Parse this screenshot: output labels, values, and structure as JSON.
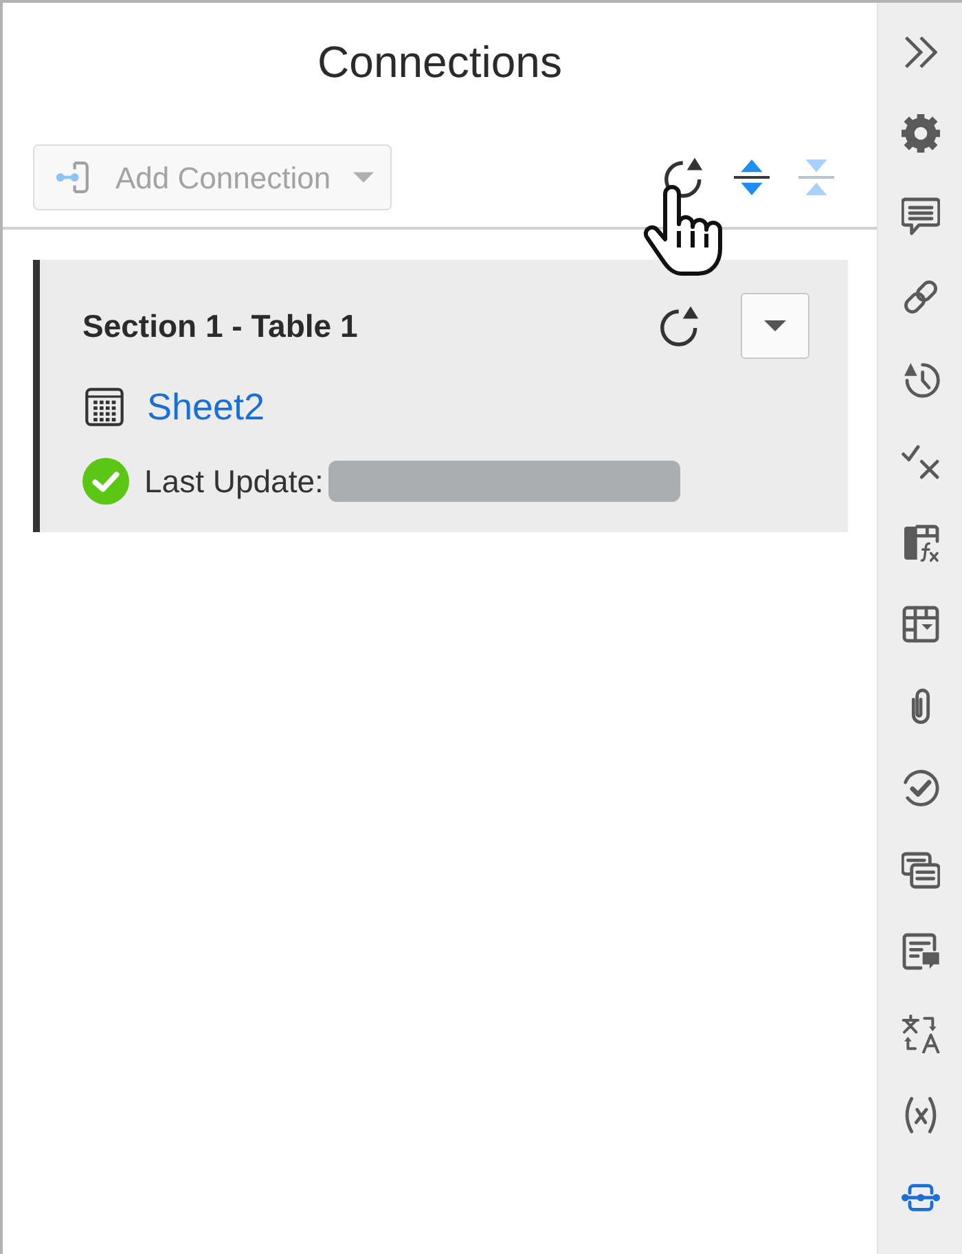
{
  "panel": {
    "title": "Connections"
  },
  "toolbar": {
    "add_button": {
      "label": "Add Connection",
      "disabled": true
    },
    "actions": [
      {
        "kind": "refresh",
        "disabled": false
      },
      {
        "kind": "expand",
        "disabled": false
      },
      {
        "kind": "collapse",
        "disabled": true
      }
    ]
  },
  "connections": [
    {
      "title": "Section 1 - Table 1",
      "sheet": "Sheet2",
      "status": {
        "label": "Last Update:",
        "ok": true
      }
    }
  ],
  "sidebar": {
    "items": [
      {
        "kind": "settings",
        "selected": false
      },
      {
        "kind": "comments",
        "selected": false
      },
      {
        "kind": "links",
        "selected": false
      },
      {
        "kind": "history",
        "selected": false
      },
      {
        "kind": "approvals",
        "selected": false
      },
      {
        "kind": "formulas",
        "selected": false
      },
      {
        "kind": "tables",
        "selected": false
      },
      {
        "kind": "attachments",
        "selected": false
      },
      {
        "kind": "proofing",
        "selected": false
      },
      {
        "kind": "conversations",
        "selected": false
      },
      {
        "kind": "summary",
        "selected": false
      },
      {
        "kind": "translation",
        "selected": false
      },
      {
        "kind": "variables",
        "selected": false
      },
      {
        "kind": "connections",
        "selected": true
      }
    ]
  }
}
